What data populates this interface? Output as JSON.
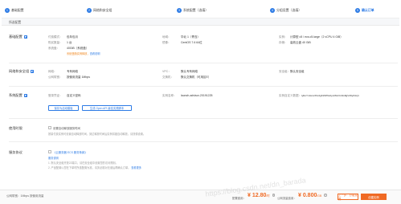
{
  "steps": [
    {
      "num": "1",
      "label": "基础配置"
    },
    {
      "num": "2",
      "label": "网络和安全组"
    },
    {
      "num": "3",
      "label": "系统配置（选填）"
    },
    {
      "num": "4",
      "label": "分组设置（选填）"
    },
    {
      "num": "5",
      "label": "确认订单"
    }
  ],
  "header": {
    "title": "所选配置"
  },
  "basic": {
    "title": "基础配置",
    "billing_k": "付费模式：",
    "billing_v": "包年包月",
    "region_k": "地域：",
    "region_v": "华北 1（青岛）",
    "instance_k": "实例：",
    "instance_v": "计算型 c5 / ecs.c5.large（2 vCPU 4 GiB）",
    "qty_k": "购买数量：",
    "qty_v": "1 台",
    "image_k": "镜像：",
    "image_v": "CentOS 7.6 64位",
    "storage_k": "存储：",
    "storage_v": "高效云盘 40 GiB",
    "disk_k": "系统盘：",
    "disk_v": "40GiB（系统盘）",
    "disk_note": "系统盘随实例释放，",
    "disk_link": "查看说明"
  },
  "network": {
    "title": "网络和安全组",
    "net_k": "网络：",
    "net_v": "专有网络",
    "vpc_k": "VPC：",
    "vpc_v": "默认专有网络",
    "sg_k": "安全组：",
    "sg_v": "默认安全组",
    "bw_k": "公网带宽：",
    "bw_v": "按使用流量 1Mbps",
    "vsw_k": "交换机：",
    "vsw_v": "默认交换机（可用区E）"
  },
  "system": {
    "title": "系统配置",
    "login_k": "登录凭证：",
    "login_v": "自定义密码",
    "name_k": "实例名称：",
    "name_v": "launch-advisor-20191225",
    "host_k": "实例自定义数据：",
    "host_v": "IyEvYmluL2Jhc2gKZWNobyAiSGVsbG8gV29ybGQi",
    "btn_template": "保存为启动模板",
    "btn_api": "生成 Open API 最佳实践脚本"
  },
  "usage": {
    "title": "使用时限",
    "checkbox_label": "设置自动释放服务时间",
    "desc": "按量付费实例可设置自动释放时间，到达释放时间后实例将被自动释放，请谨慎设置。"
  },
  "terms": {
    "title": "服务协议",
    "checkbox_label": "《云服务器 ECS 服务条款》",
    "note_title": "服务说明",
    "note1": "1. 默认安全组开放22端口，请在安全组中设置您的访问规则。",
    "note2": "2. 产品配置以您在下单时所选配置为准，请务必核对无误后再确认订单。",
    "note_link": "查看更多"
  },
  "footer": {
    "left": "公网带宽：1Mbps 按使用流量",
    "config_fee_label": "配置费用：",
    "config_fee": "¥ 12.80",
    "config_unit": "/时",
    "net_fee_label": "公网流量费用：",
    "net_fee": "¥ 0.800",
    "net_unit": "/GB",
    "prev_button": "上一步：分组设置",
    "confirm_button": "创建实例"
  },
  "watermark": "https://blog.csdn.net/dn_barada"
}
